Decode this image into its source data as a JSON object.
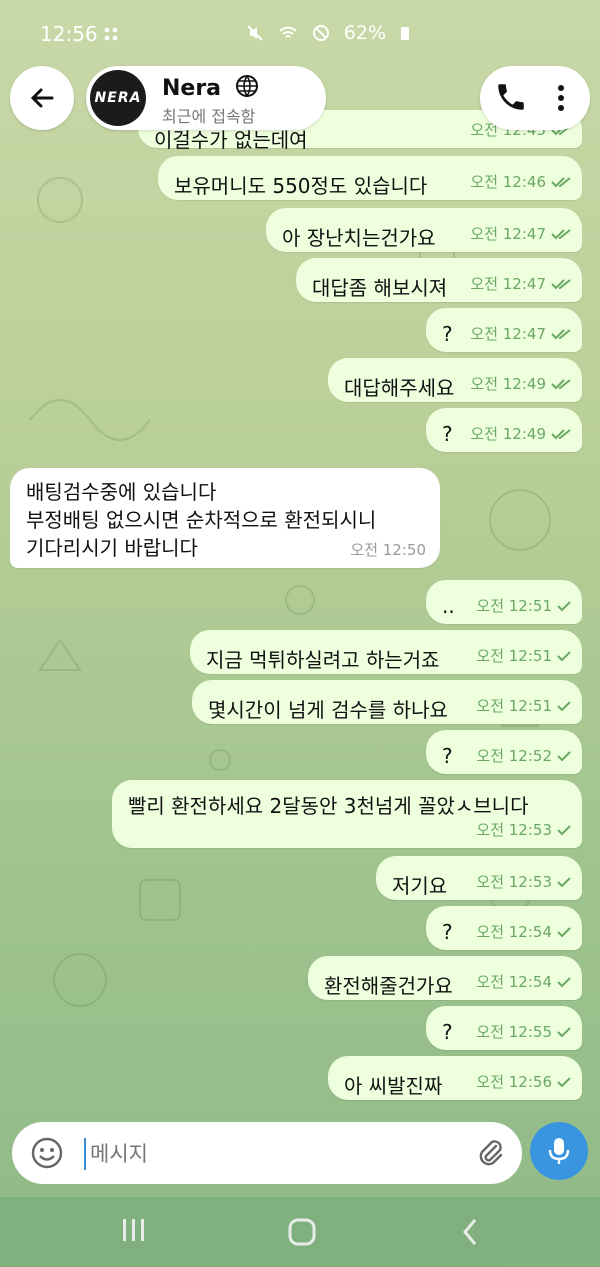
{
  "status_bar": {
    "time": "12:56",
    "battery": "62%"
  },
  "header": {
    "contact_name": "Nera",
    "contact_status": "최근에 접속함",
    "avatar_text": "NERA"
  },
  "messages": [
    {
      "dir": "out",
      "text": "이걸수가 없는데여",
      "time": "오전 12:45"
    },
    {
      "dir": "out",
      "text": "보유머니도 550정도 있습니다",
      "time": "오전 12:46"
    },
    {
      "dir": "out",
      "text": "아 장난치는건가요",
      "time": "오전 12:47"
    },
    {
      "dir": "out",
      "text": "대답좀 해보시져",
      "time": "오전 12:47"
    },
    {
      "dir": "out",
      "text": "?",
      "time": "오전 12:47"
    },
    {
      "dir": "out",
      "text": "대답해주세요",
      "time": "오전 12:49"
    },
    {
      "dir": "out",
      "text": "?",
      "time": "오전 12:49"
    },
    {
      "dir": "in",
      "text": "배팅검수중에 있습니다\n부정배팅 없으시면 순차적으로 환전되시니\n기다리시기 바랍니다",
      "time": "오전 12:50"
    },
    {
      "dir": "out",
      "text": "..",
      "time": "오전 12:51"
    },
    {
      "dir": "out",
      "text": "지금 먹튀하실려고 하는거죠",
      "time": "오전 12:51"
    },
    {
      "dir": "out",
      "text": "몇시간이 넘게 검수를 하나요",
      "time": "오전 12:51"
    },
    {
      "dir": "out",
      "text": "?",
      "time": "오전 12:52"
    },
    {
      "dir": "out",
      "text": "빨리 환전하세요 2달동안 3천넘게 꼴았ㅅ브니다",
      "time": "오전 12:53"
    },
    {
      "dir": "out",
      "text": "저기요",
      "time": "오전 12:53"
    },
    {
      "dir": "out",
      "text": "?",
      "time": "오전 12:54"
    },
    {
      "dir": "out",
      "text": "환전해줄건가요",
      "time": "오전 12:54"
    },
    {
      "dir": "out",
      "text": "?",
      "time": "오전 12:55"
    },
    {
      "dir": "out",
      "text": "아 씨발진짜",
      "time": "오전 12:56"
    }
  ],
  "composer": {
    "placeholder": "메시지"
  },
  "icons": {
    "back": "arrow-left-icon",
    "call": "phone-icon",
    "menu": "more-vert-icon",
    "emoji": "emoji-icon",
    "attach": "paperclip-icon",
    "mic": "microphone-icon"
  },
  "colors": {
    "outgoing_bubble": "#eeffde",
    "incoming_bubble": "#ffffff",
    "accent": "#3a95e0",
    "read_check": "#6aa864"
  }
}
